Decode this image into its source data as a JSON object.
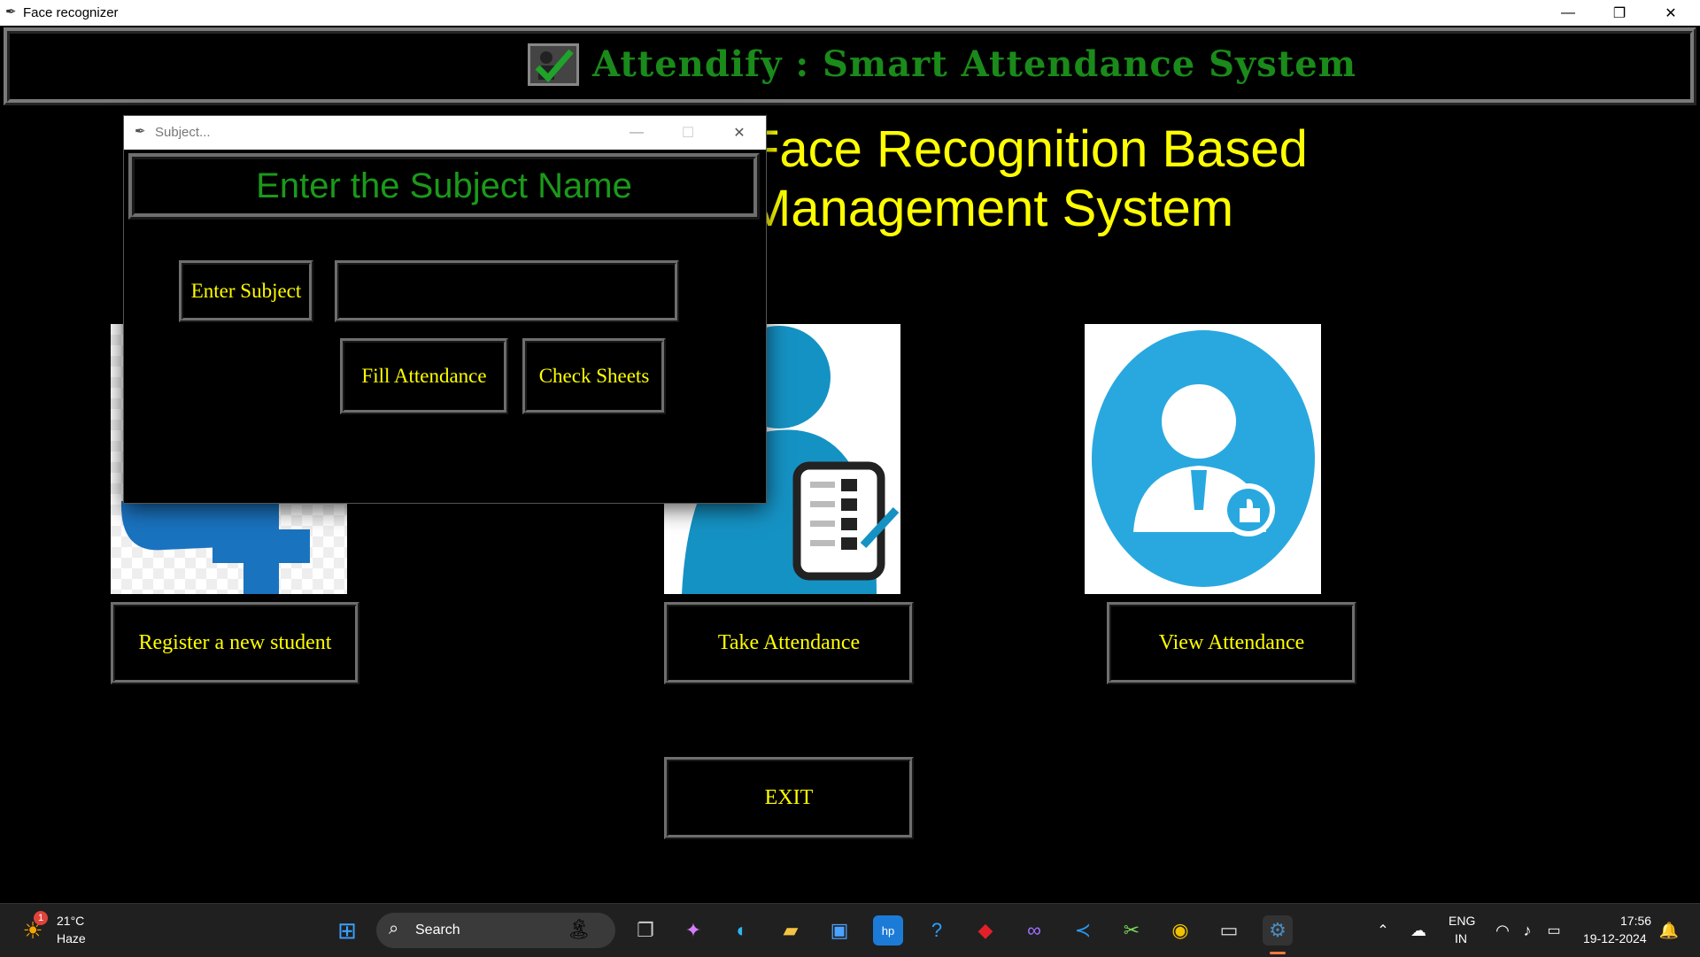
{
  "window": {
    "title": "Face recognizer",
    "minimize_glyph": "—",
    "restore_glyph": "❐",
    "close_glyph": "✕"
  },
  "header": {
    "app_title": "Attendify : Smart Attendance System",
    "logo_icon": "checkmark-logo-icon"
  },
  "main": {
    "title_line1": "Face Recognition Based",
    "title_line2": "Management System",
    "buttons": {
      "register": "Register a new student",
      "take": "Take Attendance",
      "view": "View Attendance",
      "exit": "EXIT"
    }
  },
  "dialog": {
    "title": "Subject...",
    "header": "Enter the Subject Name",
    "enter_subject_label": "Enter Subject",
    "subject_value": "",
    "fill_button": "Fill Attendance",
    "check_button": "Check Sheets"
  },
  "taskbar": {
    "weather_temp": "21°C",
    "weather_desc": "Haze",
    "weather_badge": "1",
    "search_label": "Search",
    "lang_line1": "ENG",
    "lang_line2": "IN",
    "time": "17:56",
    "date": "19-12-2024"
  },
  "colors": {
    "accent_yellow": "#ffff00",
    "header_green": "#1a8a1a",
    "border_gray": "#6e6e6e",
    "icon_blue": "#29a8e0"
  }
}
